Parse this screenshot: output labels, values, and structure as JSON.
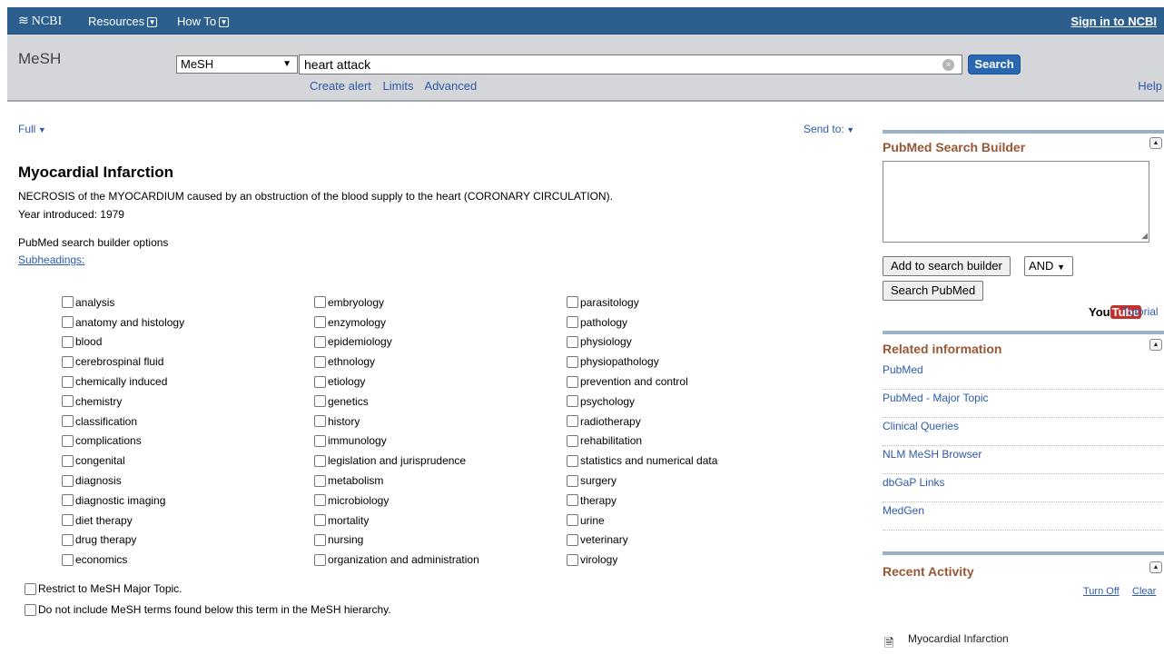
{
  "topbar": {
    "brand": "NCBI",
    "resources": "Resources",
    "howto": "How To",
    "signin": "Sign in to NCBI"
  },
  "search": {
    "db_label": "MeSH",
    "db_selected": "MeSH",
    "term": "heart attack",
    "button": "Search",
    "links": [
      "Create alert",
      "Limits",
      "Advanced"
    ],
    "help": "Help"
  },
  "display": {
    "format": "Full",
    "send_to": "Send to:"
  },
  "record": {
    "title": "Myocardial Infarction",
    "scope_note": "NECROSIS of the MYOCARDIUM caused by an obstruction of the blood supply to the heart (CORONARY CIRCULATION).",
    "year_introduced": "Year introduced: 1979",
    "builder_options": "PubMed search builder options",
    "subheadings_label": "Subheadings:",
    "subheadings": [
      [
        "analysis",
        "anatomy and histology",
        "blood",
        "cerebrospinal fluid",
        "chemically induced",
        "chemistry",
        "classification",
        "complications",
        "congenital",
        "diagnosis",
        "diagnostic imaging",
        "diet therapy",
        "drug therapy",
        "economics"
      ],
      [
        "embryology",
        "enzymology",
        "epidemiology",
        "ethnology",
        "etiology",
        "genetics",
        "history",
        "immunology",
        "legislation and jurisprudence",
        "metabolism",
        "microbiology",
        "mortality",
        "nursing",
        "organization and administration"
      ],
      [
        "parasitology",
        "pathology",
        "physiology",
        "physiopathology",
        "prevention and control",
        "psychology",
        "radiotherapy",
        "rehabilitation",
        "statistics and numerical data",
        "surgery",
        "therapy",
        "urine",
        "veterinary",
        "virology"
      ]
    ],
    "restrict_major": "Restrict to MeSH Major Topic.",
    "no_explode": "Do not include MeSH terms found below this term in the MeSH hierarchy."
  },
  "sidebar": {
    "builder_title": "PubMed Search Builder",
    "add_button": "Add to search builder",
    "operator": "AND",
    "search_pubmed_button": "Search PubMed",
    "youtube_you": "You",
    "youtube_tube": "Tube",
    "tutorial": "Tutorial",
    "related_title": "Related information",
    "related_items": [
      "PubMed",
      "PubMed - Major Topic",
      "Clinical Queries",
      "NLM MeSH Browser",
      "dbGaP Links",
      "MedGen"
    ],
    "activity_title": "Recent Activity",
    "turn_off": "Turn Off",
    "clear": "Clear",
    "activity_item": "Myocardial Infarction"
  },
  "colors": {
    "topbar": "#2d5f8e",
    "searchband": "#d4d6d9",
    "link": "#2f5aa8",
    "portlet_title": "#985735",
    "search_button": "#2a67b1"
  }
}
